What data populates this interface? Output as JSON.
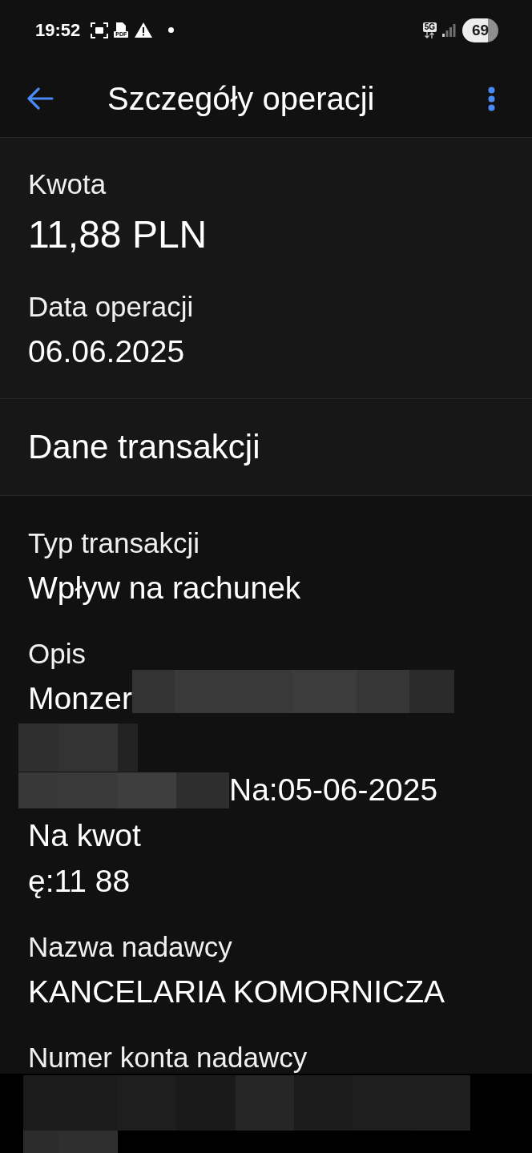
{
  "status_bar": {
    "time": "19:52",
    "file_badge": "PDF",
    "network": "5G",
    "battery": "69"
  },
  "header": {
    "title": "Szczegóły operacji"
  },
  "summary": [
    {
      "kind": "amount",
      "label": "Kwota",
      "value": "11,88 PLN"
    },
    {
      "kind": "plain",
      "label": "Data operacji",
      "value": "06.06.2025"
    }
  ],
  "section": {
    "title": "Dane transakcji"
  },
  "details": [
    {
      "kind": "field",
      "label": "Typ transakcji",
      "lines": [
        [
          {
            "kind": "text",
            "text": "Wpływ na rachunek"
          }
        ]
      ]
    },
    {
      "kind": "field",
      "label": "Opis",
      "lines": [
        [
          {
            "kind": "text",
            "text": "Monzer"
          },
          {
            "kind": "redacted"
          }
        ],
        [
          {
            "kind": "redacted"
          }
        ],
        [
          {
            "kind": "redacted"
          },
          {
            "kind": "text",
            "text": "Na:05-06-2025"
          }
        ],
        [
          {
            "kind": "text",
            "text": "Na kwot"
          }
        ],
        [
          {
            "kind": "text",
            "text": "ę:11 88"
          }
        ]
      ]
    },
    {
      "kind": "field",
      "label": "Nazwa nadawcy",
      "lines": [
        [
          {
            "kind": "text",
            "text": "KANCELARIA KOMORNICZA"
          }
        ]
      ]
    },
    {
      "kind": "masked",
      "label": "Numer konta nadawcy",
      "lines": [
        [
          {
            "kind": "redacted"
          }
        ],
        [
          {
            "kind": "redacted"
          }
        ]
      ]
    }
  ]
}
